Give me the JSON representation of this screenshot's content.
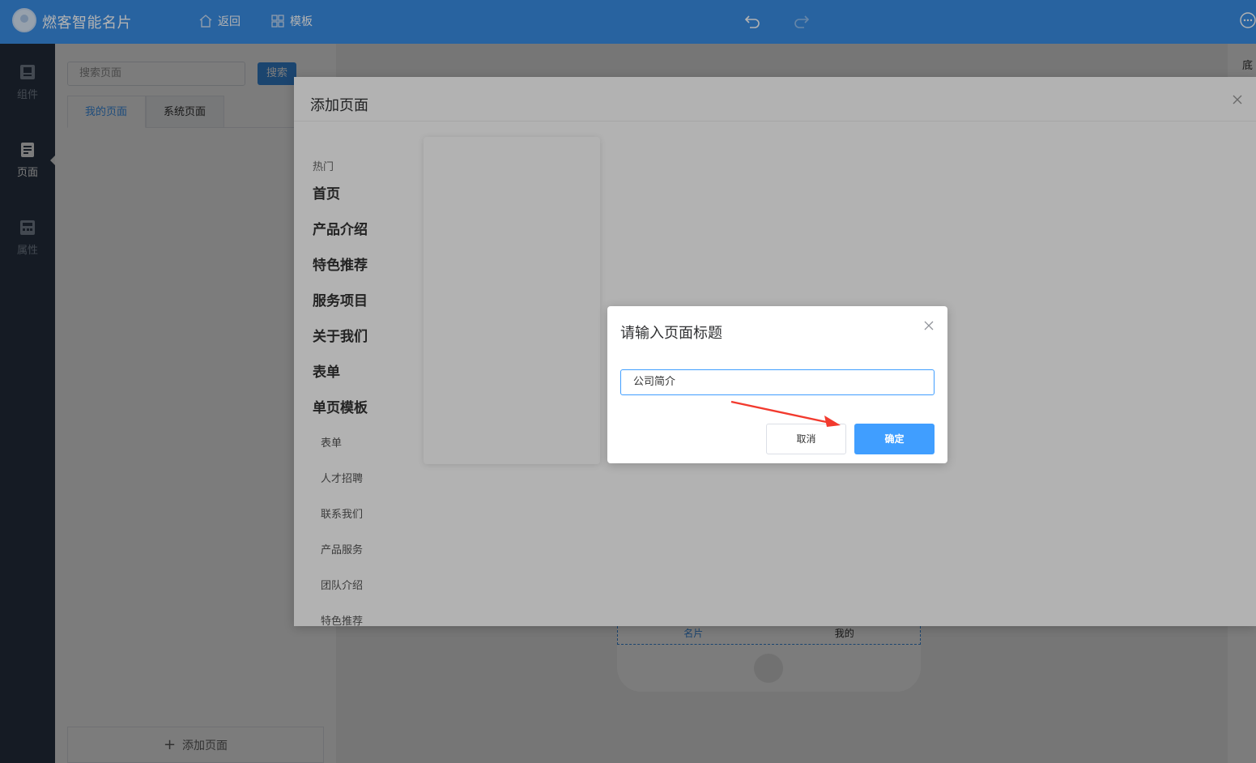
{
  "app": {
    "title": "燃客智能名片",
    "nav_back": "返回",
    "nav_template": "模板",
    "accent": "#3a8ee6"
  },
  "iconbar": {
    "items": [
      {
        "label": "组件",
        "icon": "component-icon"
      },
      {
        "label": "页面",
        "icon": "page-icon",
        "active": true
      },
      {
        "label": "属性",
        "icon": "property-icon"
      }
    ]
  },
  "pagepanel": {
    "search_placeholder": "搜索页面",
    "search_button": "搜索",
    "tabs": [
      "我的页面",
      "系统页面"
    ],
    "add_page": "添加页面"
  },
  "canvas": {
    "phone_tabs": [
      "名片",
      "我的"
    ]
  },
  "rightpanel": {
    "label": "底"
  },
  "add_dialog": {
    "title": "添加页面",
    "group_label": "热门",
    "categories": [
      "首页",
      "产品介绍",
      "特色推荐",
      "服务项目",
      "关于我们",
      "表单",
      "单页模板"
    ],
    "subcategories": [
      "表单",
      "人才招聘",
      "联系我们",
      "产品服务",
      "团队介绍",
      "特色推荐"
    ]
  },
  "prompt": {
    "title": "请输入页面标题",
    "input_value": "公司简介",
    "cancel": "取消",
    "confirm": "确定",
    "confirm_color": "#409eff"
  }
}
